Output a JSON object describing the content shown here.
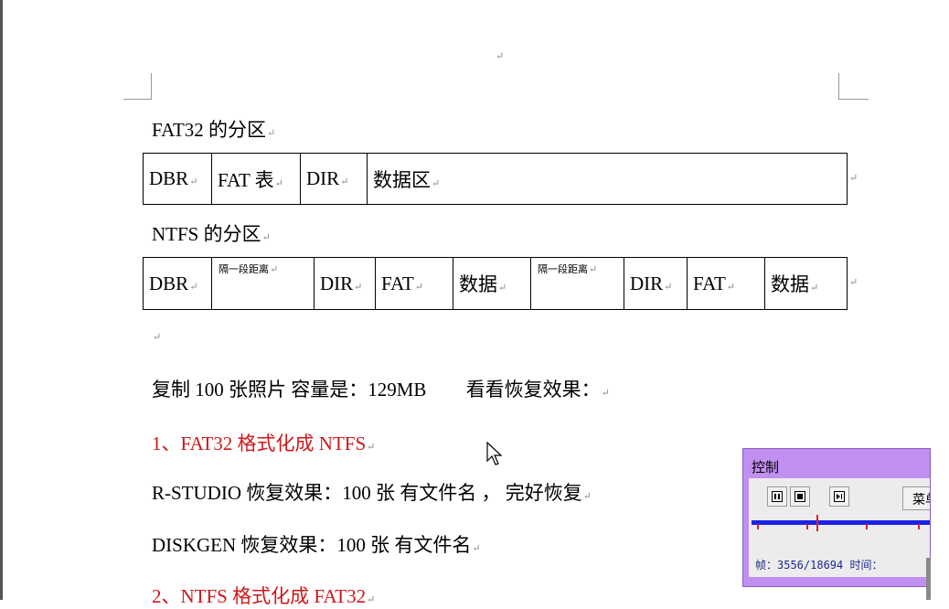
{
  "document": {
    "paragraph_mark": "↵",
    "fat32_heading": "FAT32 的分区",
    "fat32_table": [
      "DBR",
      "FAT 表",
      "DIR",
      "数据区"
    ],
    "ntfs_heading": "NTFS 的分区",
    "ntfs_table": [
      "DBR",
      "隔一段距离",
      "DIR",
      "FAT",
      "数据",
      "隔一段距离",
      "DIR",
      "FAT",
      "数据"
    ],
    "line_copy": "复制 100 张照片 容量是：129MB",
    "line_check": "看看恢复效果：",
    "line_step1": "1、FAT32 格式化成 NTFS",
    "line_rstudio": "R-STUDIO 恢复效果：100 张   有文件名 ， 完好恢复",
    "line_diskgen": "DISKGEN 恢复效果：100 张    有文件名",
    "line_step2": "2、NTFS 格式化成 FAT32",
    "colors": {
      "red_text": "#d0161a",
      "panel_bg": "#c08ff0",
      "track": "#1b22e6"
    }
  },
  "control_panel": {
    "title": "控制",
    "menu_label": "菜单",
    "status": "帧：3556/18694 时间：",
    "progress_fraction": 0.19,
    "buttons": [
      "pause-icon",
      "stop-icon",
      "step-forward-icon"
    ]
  }
}
